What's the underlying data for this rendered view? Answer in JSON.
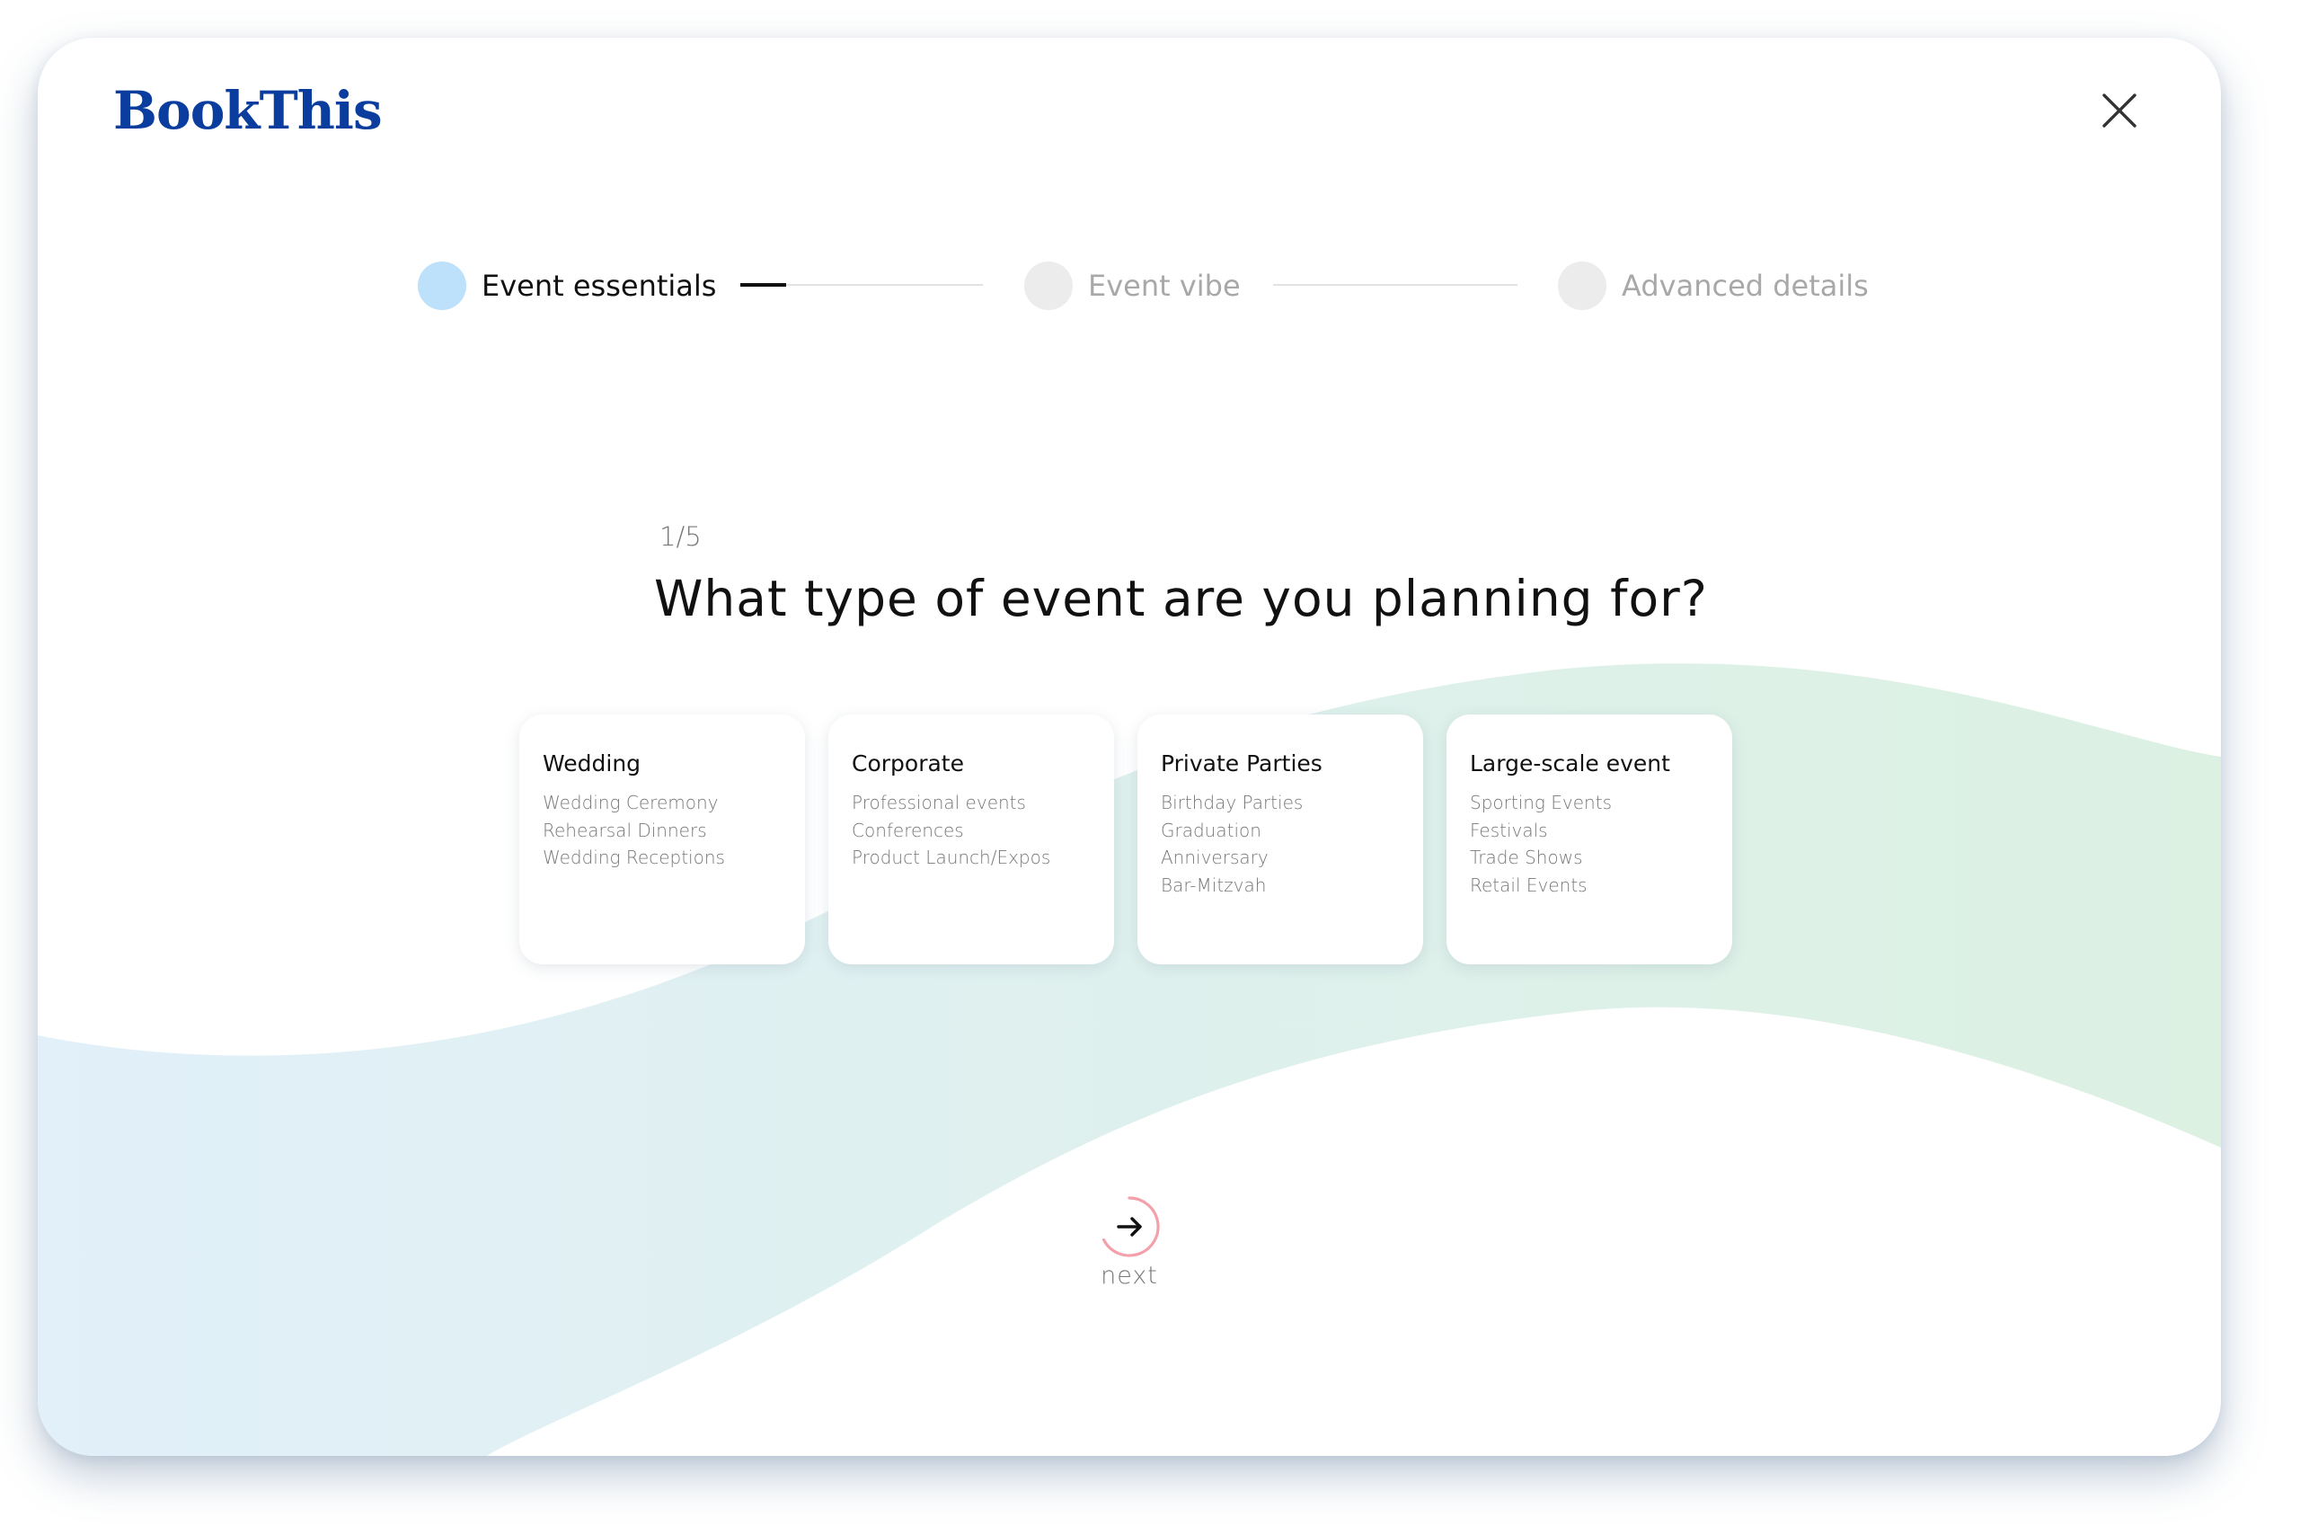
{
  "brand": {
    "name": "BookThis",
    "color": "#0b3d9e"
  },
  "colors": {
    "text_primary": "#111111",
    "text_muted": "#777777",
    "text_faint": "#a8a8a8",
    "step_active": "#bde0fb",
    "step_inactive": "#ececec",
    "accent_ring": "#f4a0ab",
    "wave_blue": "#e1f0f9",
    "wave_green": "#dcf1e2"
  },
  "stepper": {
    "steps": [
      {
        "label": "Event essentials",
        "state": "active"
      },
      {
        "label": "Event vibe",
        "state": "inactive"
      },
      {
        "label": "Advanced details",
        "state": "inactive"
      }
    ],
    "first_connector_progress": 0.19
  },
  "question": {
    "counter": "1/5",
    "text": "What type of event are you planning for?"
  },
  "options": [
    {
      "title": "Wedding",
      "items": [
        "Wedding Ceremony",
        "Rehearsal Dinners",
        "Wedding Receptions"
      ]
    },
    {
      "title": "Corporate",
      "items": [
        "Professional events",
        "Conferences",
        "Product Launch/Expos"
      ]
    },
    {
      "title": "Private Parties",
      "items": [
        "Birthday Parties",
        "Graduation",
        "Anniversary",
        "Bar-Mitzvah"
      ]
    },
    {
      "title": "Large-scale event",
      "items": [
        "Sporting Events",
        "Festivals",
        "Trade Shows",
        "Retail Events"
      ]
    }
  ],
  "actions": {
    "next_label": "next",
    "next_icon": "arrow-right-icon",
    "close_icon": "close-icon"
  }
}
